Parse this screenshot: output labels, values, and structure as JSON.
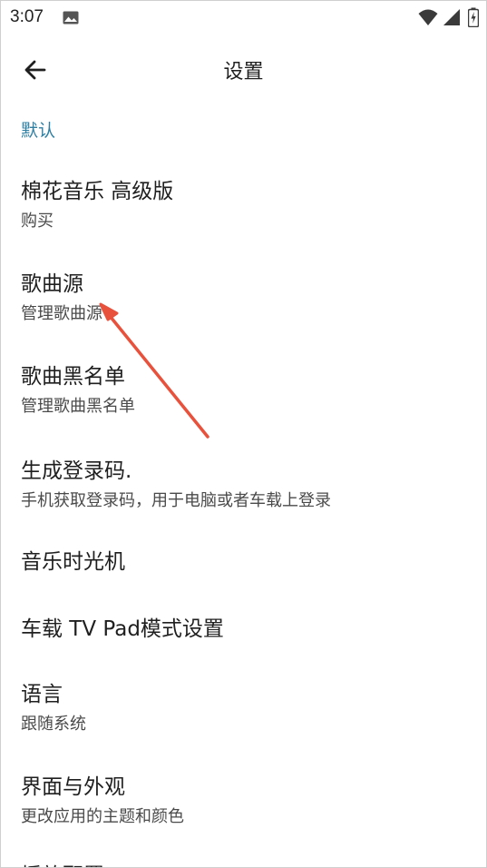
{
  "status_bar": {
    "time": "3:07",
    "icons": [
      "gallery-icon",
      "wifi-icon",
      "signal-icon",
      "battery-icon"
    ]
  },
  "app_bar": {
    "title": "设置",
    "back_icon": "arrow-left-icon"
  },
  "section": {
    "header": "默认"
  },
  "items": [
    {
      "title": "棉花音乐 高级版",
      "subtitle": "购买"
    },
    {
      "title": "歌曲源",
      "subtitle": "管理歌曲源"
    },
    {
      "title": "歌曲黑名单",
      "subtitle": "管理歌曲黑名单"
    },
    {
      "title": "生成登录码.",
      "subtitle": "手机获取登录码，用于电脑或者车载上登录"
    },
    {
      "title": "音乐时光机",
      "subtitle": ""
    },
    {
      "title": "车载 TV Pad模式设置",
      "subtitle": ""
    },
    {
      "title": "语言",
      "subtitle": "跟随系统"
    },
    {
      "title": "界面与外观",
      "subtitle": "更改应用的主题和颜色"
    },
    {
      "title": "播放配置",
      "subtitle": ""
    }
  ],
  "colors": {
    "section_header": "#2f7fa3",
    "annotation_arrow": "#e8513b"
  }
}
